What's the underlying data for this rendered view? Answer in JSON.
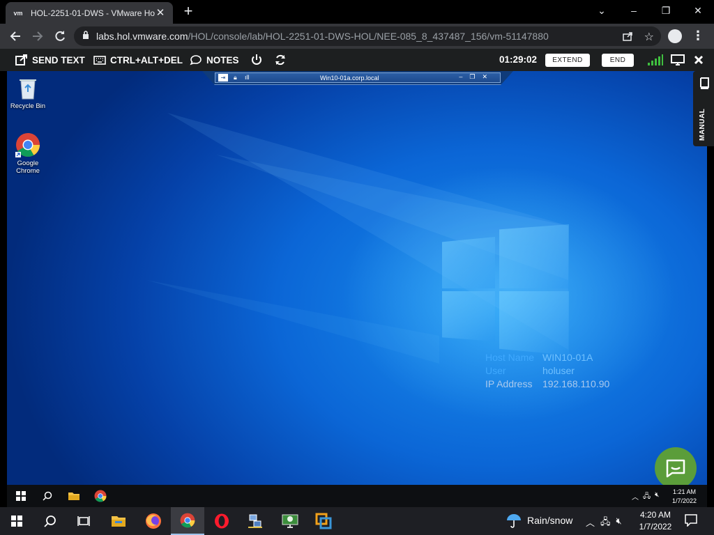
{
  "browser": {
    "tab": {
      "favicon": "vm",
      "title": "HOL-2251-01-DWS - VMware Ho",
      "close": "✕"
    },
    "new_tab": "+",
    "window_controls": {
      "minimize": "–",
      "maximize": "❐",
      "close": "✕",
      "dropdown": "⌄"
    },
    "url_host": "labs.hol.vmware.com",
    "url_path": "/HOL/console/lab/HOL-2251-01-DWS-HOL/NEE-085_8_437487_156/vm-51147880"
  },
  "hol_toolbar": {
    "send_text": "SEND TEXT",
    "ctrl_alt_del": "CTRL+ALT+DEL",
    "notes": "NOTES",
    "timer": "01:29:02",
    "extend": "EXTEND",
    "end": "END",
    "manual": "MANUAL"
  },
  "vm_bar": {
    "title": "Win10-01a.corp.local"
  },
  "desktop": {
    "icons": [
      {
        "label": "Recycle Bin"
      },
      {
        "label_line1": "Google",
        "label_line2": "Chrome"
      }
    ],
    "host_info": {
      "host_key": "Host Name",
      "host_val": "WIN10-01A",
      "user_key": "User",
      "user_val": "holuser",
      "ip_key": "IP Address",
      "ip_val": "192.168.110.90"
    }
  },
  "inner_taskbar": {
    "time": "1:21 AM",
    "date": "1/7/2022"
  },
  "outer_taskbar": {
    "weather": "Rain/snow",
    "time": "4:20 AM",
    "date": "1/7/2022"
  },
  "colors": {
    "desktop_blue": "#0b66d6",
    "chat_green": "#5b9d3a",
    "hol_bar": "#1d1f20"
  }
}
